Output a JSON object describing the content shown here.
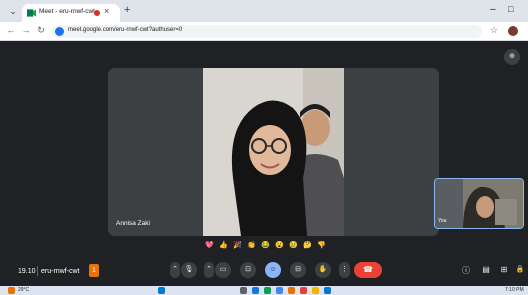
{
  "browser": {
    "tab_title": "Meet - eru-rnwf-cwt",
    "new_tab_icon": "+",
    "url": "meet.google.com/eru-rnwf-cwt?authuser=0",
    "minimize_icon": "–",
    "maximize_icon": "□"
  },
  "meeting": {
    "speaker_name": "Annisa Zaki",
    "self_name": "You",
    "time": "19.10",
    "code": "eru-rnwf-cwt",
    "code_badge": "1"
  },
  "reactions": [
    "💖",
    "👍",
    "🎉",
    "👏",
    "😂",
    "😮",
    "😢",
    "🤔",
    "👎"
  ],
  "controls": {
    "more_caret": "⌃",
    "mic": "🎙",
    "cam_caret": "⌃",
    "camera": "▭",
    "captions": "⊡",
    "emoji": "☺",
    "present": "⊟",
    "raise_hand": "✋",
    "more": "⋮",
    "end_call": "☎"
  },
  "right_controls": {
    "info": "ⓘ",
    "chat": "▤",
    "activities": "⊞",
    "lock": "🔒"
  },
  "taskbar": {
    "temp": "29°C",
    "time": "7:10 PM"
  },
  "colors": {
    "meet_bg": "#202124",
    "tile_bg": "#3c4043",
    "accent": "#8ab4f8",
    "end_call": "#ea4335"
  }
}
